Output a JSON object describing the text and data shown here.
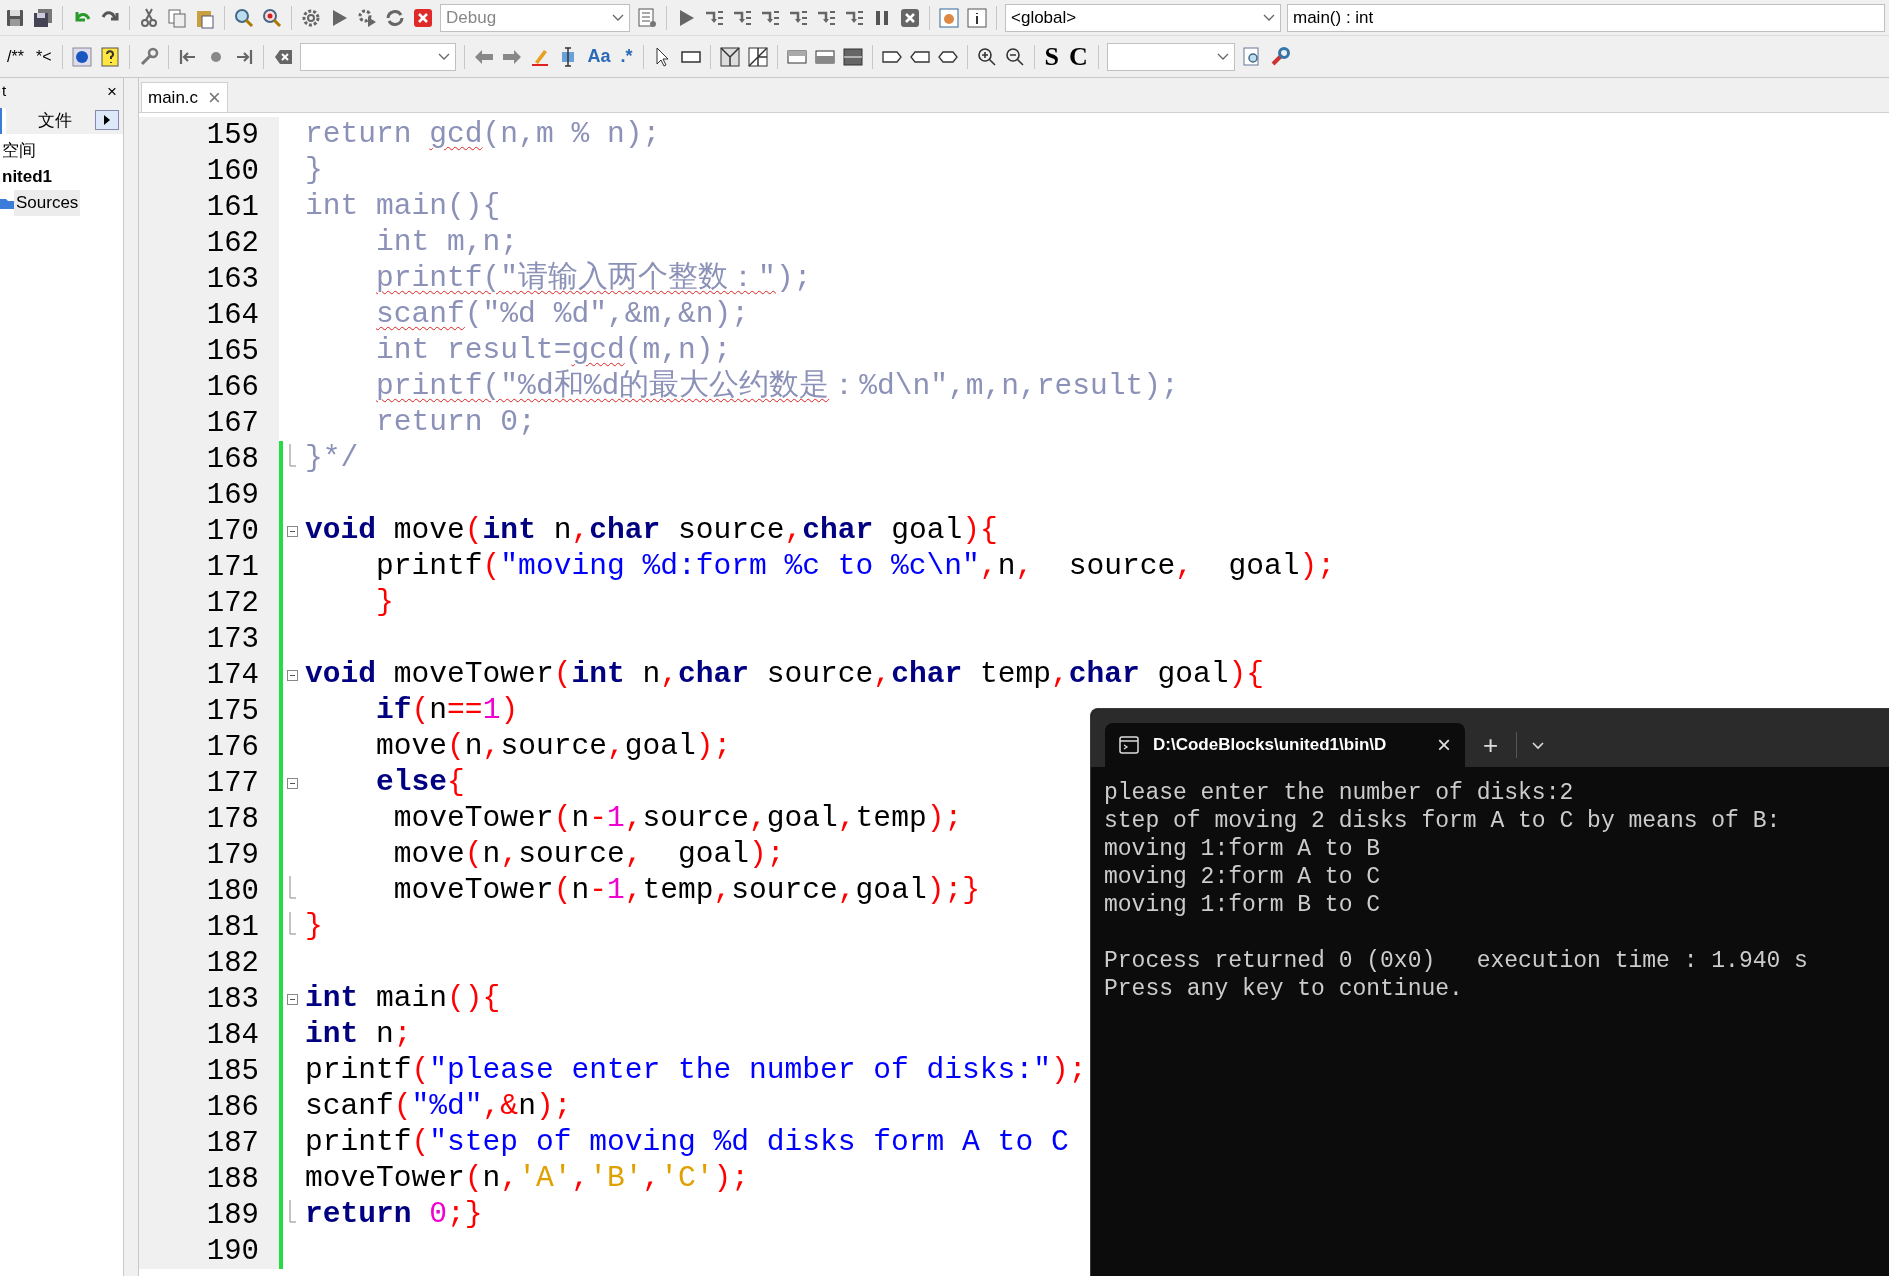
{
  "toolbar": {
    "build_target": "Debug",
    "scope": "<global>",
    "symbol": "main() : int",
    "comment_buttons": [
      "/**",
      "*<"
    ],
    "search_buttons": [
      "Aa",
      ".*"
    ],
    "letter_buttons": [
      "S",
      "C"
    ]
  },
  "left_panel": {
    "title": "t",
    "close": "×",
    "tabs": [
      {
        "label": "文件",
        "selected": false
      }
    ],
    "tree": [
      {
        "label": "空间",
        "selected": false,
        "children": [
          {
            "label": "nited1",
            "selected": false,
            "children": [
              {
                "label": "Sources",
                "selected": true
              }
            ]
          }
        ]
      }
    ]
  },
  "editor": {
    "tab": {
      "label": "main.c",
      "close": "×"
    },
    "lines": [
      {
        "number": "159",
        "changed": false,
        "segments": [
          {
            "kind": "comment",
            "text": "return "
          },
          {
            "kind": "comment",
            "text": "gcd",
            "spell": true
          },
          {
            "kind": "comment",
            "text": "(n,m % n);"
          }
        ]
      },
      {
        "number": "160",
        "changed": false,
        "segments": [
          {
            "kind": "comment",
            "text": "}"
          }
        ]
      },
      {
        "number": "161",
        "changed": false,
        "segments": [
          {
            "kind": "comment",
            "text": "int main(){"
          }
        ]
      },
      {
        "number": "162",
        "changed": false,
        "segments": [
          {
            "kind": "comment",
            "text": "    int m,n;"
          }
        ]
      },
      {
        "number": "163",
        "changed": false,
        "segments": [
          {
            "kind": "comment",
            "text": "    printf(\"请输入两个整数：\"",
            "spell": true
          },
          {
            "kind": "comment",
            "text": ");"
          }
        ]
      },
      {
        "number": "164",
        "changed": false,
        "segments": [
          {
            "kind": "comment",
            "text": "    scanf",
            "spell": true
          },
          {
            "kind": "comment",
            "text": "(\"%d %d\",&m,&n);"
          }
        ]
      },
      {
        "number": "165",
        "changed": false,
        "segments": [
          {
            "kind": "comment",
            "text": "    int result="
          },
          {
            "kind": "comment",
            "text": "gcd",
            "spell": true
          },
          {
            "kind": "comment",
            "text": "(m,n);"
          }
        ]
      },
      {
        "number": "166",
        "changed": false,
        "segments": [
          {
            "kind": "comment",
            "text": "    printf(\"%d和%d的最大公约数是",
            "spell": true
          },
          {
            "kind": "comment",
            "text": "：%d\\n\",m,n,result);"
          }
        ]
      },
      {
        "number": "167",
        "changed": false,
        "segments": [
          {
            "kind": "comment",
            "text": "    return 0;"
          }
        ]
      },
      {
        "number": "168",
        "changed": true,
        "fold_end": true,
        "segments": [
          {
            "kind": "comment",
            "text": "}*/"
          }
        ]
      },
      {
        "number": "169",
        "changed": true
      },
      {
        "number": "170",
        "changed": true,
        "fold_start": true,
        "segments": [
          {
            "kind": "kw",
            "text": "void"
          },
          {
            "kind": "plain",
            "text": " move"
          },
          {
            "kind": "punct",
            "text": "("
          },
          {
            "kind": "kw",
            "text": "int"
          },
          {
            "kind": "plain",
            "text": " n"
          },
          {
            "kind": "punct",
            "text": ","
          },
          {
            "kind": "kw",
            "text": "char"
          },
          {
            "kind": "plain",
            "text": " source"
          },
          {
            "kind": "punct",
            "text": ","
          },
          {
            "kind": "kw",
            "text": "char"
          },
          {
            "kind": "plain",
            "text": " goal"
          },
          {
            "kind": "punct",
            "text": "){"
          }
        ]
      },
      {
        "number": "171",
        "changed": true,
        "segments": [
          {
            "kind": "plain",
            "text": "    printf"
          },
          {
            "kind": "punct",
            "text": "("
          },
          {
            "kind": "str",
            "text": "\"moving %d:form %c to %c\\n\""
          },
          {
            "kind": "punct",
            "text": ","
          },
          {
            "kind": "plain",
            "text": "n"
          },
          {
            "kind": "punct",
            "text": ","
          },
          {
            "kind": "plain",
            "text": "  source"
          },
          {
            "kind": "punct",
            "text": ","
          },
          {
            "kind": "plain",
            "text": "  goal"
          },
          {
            "kind": "punct",
            "text": ");"
          }
        ]
      },
      {
        "number": "172",
        "changed": true,
        "segments": [
          {
            "kind": "punct",
            "text": "    }"
          }
        ]
      },
      {
        "number": "173",
        "changed": true
      },
      {
        "number": "174",
        "changed": true,
        "fold_start": true,
        "segments": [
          {
            "kind": "kw",
            "text": "void"
          },
          {
            "kind": "plain",
            "text": " moveTower"
          },
          {
            "kind": "punct",
            "text": "("
          },
          {
            "kind": "kw",
            "text": "int"
          },
          {
            "kind": "plain",
            "text": " n"
          },
          {
            "kind": "punct",
            "text": ","
          },
          {
            "kind": "kw",
            "text": "char"
          },
          {
            "kind": "plain",
            "text": " source"
          },
          {
            "kind": "punct",
            "text": ","
          },
          {
            "kind": "kw",
            "text": "char"
          },
          {
            "kind": "plain",
            "text": " temp"
          },
          {
            "kind": "punct",
            "text": ","
          },
          {
            "kind": "kw",
            "text": "char"
          },
          {
            "kind": "plain",
            "text": " goal"
          },
          {
            "kind": "punct",
            "text": "){"
          }
        ]
      },
      {
        "number": "175",
        "changed": true,
        "segments": [
          {
            "kind": "kw",
            "text": "    if"
          },
          {
            "kind": "punct",
            "text": "("
          },
          {
            "kind": "plain",
            "text": "n"
          },
          {
            "kind": "punct",
            "text": "=="
          },
          {
            "kind": "num",
            "text": "1"
          },
          {
            "kind": "punct",
            "text": ")"
          }
        ]
      },
      {
        "number": "176",
        "changed": true,
        "segments": [
          {
            "kind": "plain",
            "text": "    move"
          },
          {
            "kind": "punct",
            "text": "("
          },
          {
            "kind": "plain",
            "text": "n"
          },
          {
            "kind": "punct",
            "text": ","
          },
          {
            "kind": "plain",
            "text": "source"
          },
          {
            "kind": "punct",
            "text": ","
          },
          {
            "kind": "plain",
            "text": "goal"
          },
          {
            "kind": "punct",
            "text": ");"
          }
        ]
      },
      {
        "number": "177",
        "changed": true,
        "fold_start": true,
        "segments": [
          {
            "kind": "kw",
            "text": "    else"
          },
          {
            "kind": "punct",
            "text": "{"
          }
        ]
      },
      {
        "number": "178",
        "changed": true,
        "segments": [
          {
            "kind": "plain",
            "text": "     moveTower"
          },
          {
            "kind": "punct",
            "text": "("
          },
          {
            "kind": "plain",
            "text": "n"
          },
          {
            "kind": "punct",
            "text": "-"
          },
          {
            "kind": "num",
            "text": "1"
          },
          {
            "kind": "punct",
            "text": ","
          },
          {
            "kind": "plain",
            "text": "source"
          },
          {
            "kind": "punct",
            "text": ","
          },
          {
            "kind": "plain",
            "text": "goal"
          },
          {
            "kind": "punct",
            "text": ","
          },
          {
            "kind": "plain",
            "text": "temp"
          },
          {
            "kind": "punct",
            "text": ");"
          }
        ]
      },
      {
        "number": "179",
        "changed": true,
        "segments": [
          {
            "kind": "plain",
            "text": "     move"
          },
          {
            "kind": "punct",
            "text": "("
          },
          {
            "kind": "plain",
            "text": "n"
          },
          {
            "kind": "punct",
            "text": ","
          },
          {
            "kind": "plain",
            "text": "source"
          },
          {
            "kind": "punct",
            "text": ","
          },
          {
            "kind": "plain",
            "text": "  goal"
          },
          {
            "kind": "punct",
            "text": ");"
          }
        ]
      },
      {
        "number": "180",
        "changed": true,
        "fold_end": true,
        "segments": [
          {
            "kind": "plain",
            "text": "     moveTower"
          },
          {
            "kind": "punct",
            "text": "("
          },
          {
            "kind": "plain",
            "text": "n"
          },
          {
            "kind": "punct",
            "text": "-"
          },
          {
            "kind": "num",
            "text": "1"
          },
          {
            "kind": "punct",
            "text": ","
          },
          {
            "kind": "plain",
            "text": "temp"
          },
          {
            "kind": "punct",
            "text": ","
          },
          {
            "kind": "plain",
            "text": "source"
          },
          {
            "kind": "punct",
            "text": ","
          },
          {
            "kind": "plain",
            "text": "goal"
          },
          {
            "kind": "punct",
            "text": ");}"
          }
        ]
      },
      {
        "number": "181",
        "changed": true,
        "fold_end": true,
        "segments": [
          {
            "kind": "punct",
            "text": "}"
          }
        ]
      },
      {
        "number": "182",
        "changed": true
      },
      {
        "number": "183",
        "changed": true,
        "fold_start": true,
        "segments": [
          {
            "kind": "kw",
            "text": "int"
          },
          {
            "kind": "plain",
            "text": " main"
          },
          {
            "kind": "punct",
            "text": "(){"
          }
        ]
      },
      {
        "number": "184",
        "changed": true,
        "segments": [
          {
            "kind": "kw",
            "text": "int"
          },
          {
            "kind": "plain",
            "text": " n"
          },
          {
            "kind": "punct",
            "text": ";"
          }
        ]
      },
      {
        "number": "185",
        "changed": true,
        "segments": [
          {
            "kind": "plain",
            "text": "printf"
          },
          {
            "kind": "punct",
            "text": "("
          },
          {
            "kind": "str",
            "text": "\"please enter the number of disks:\""
          },
          {
            "kind": "punct",
            "text": ");"
          }
        ]
      },
      {
        "number": "186",
        "changed": true,
        "segments": [
          {
            "kind": "plain",
            "text": "scanf"
          },
          {
            "kind": "punct",
            "text": "("
          },
          {
            "kind": "str",
            "text": "\"%d\""
          },
          {
            "kind": "punct",
            "text": ",&"
          },
          {
            "kind": "plain",
            "text": "n"
          },
          {
            "kind": "punct",
            "text": ");"
          }
        ]
      },
      {
        "number": "187",
        "changed": true,
        "segments": [
          {
            "kind": "plain",
            "text": "printf"
          },
          {
            "kind": "punct",
            "text": "("
          },
          {
            "kind": "str",
            "text": "\"step of moving %d disks form A to C"
          }
        ]
      },
      {
        "number": "188",
        "changed": true,
        "segments": [
          {
            "kind": "plain",
            "text": "moveTower"
          },
          {
            "kind": "punct",
            "text": "("
          },
          {
            "kind": "plain",
            "text": "n"
          },
          {
            "kind": "punct",
            "text": ","
          },
          {
            "kind": "char",
            "text": "'A'"
          },
          {
            "kind": "punct",
            "text": ","
          },
          {
            "kind": "char",
            "text": "'B'"
          },
          {
            "kind": "punct",
            "text": ","
          },
          {
            "kind": "char",
            "text": "'C'"
          },
          {
            "kind": "punct",
            "text": ");"
          }
        ]
      },
      {
        "number": "189",
        "changed": true,
        "fold_end": true,
        "segments": [
          {
            "kind": "kw",
            "text": "return "
          },
          {
            "kind": "num",
            "text": "0"
          },
          {
            "kind": "punct",
            "text": ";}"
          }
        ]
      },
      {
        "number": "190",
        "changed": true
      }
    ]
  },
  "console": {
    "tab_title": "D:\\CodeBlocks\\united1\\bin\\D",
    "close": "×",
    "new_tab": "+",
    "output": [
      "please enter the number of disks:2",
      "step of moving 2 disks form A to C by means of B:",
      "moving 1:form A to B",
      "moving 2:form A to C",
      "moving 1:form B to C"
    ],
    "summary": [
      "Process returned 0 (0x0)   execution time : 1.940 s",
      "Press any key to continue."
    ]
  }
}
